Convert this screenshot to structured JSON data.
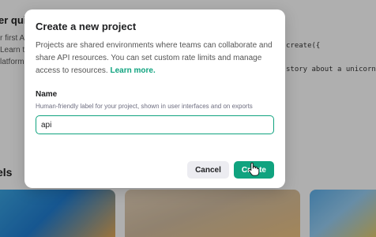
{
  "background": {
    "heading": "er qui",
    "lines": [
      "r first A",
      "Learn t",
      "latform"
    ],
    "code_lines": [
      "create({",
      "story about a unicorn."
    ],
    "models_heading": "els"
  },
  "dialog": {
    "title": "Create a new project",
    "description": "Projects are shared environments where teams can collaborate and share API resources. You can set custom rate limits and manage access to resources.",
    "learn_more": "Learn more.",
    "name_label": "Name",
    "name_hint": "Human-friendly label for your project, shown in user interfaces and on exports",
    "name_value": "api",
    "cancel_label": "Cancel",
    "create_label": "Create"
  },
  "colors": {
    "accent": "#10a37f",
    "cancel_bg": "#ececf1"
  },
  "icons": {
    "cursor": "hand-pointer-icon"
  }
}
